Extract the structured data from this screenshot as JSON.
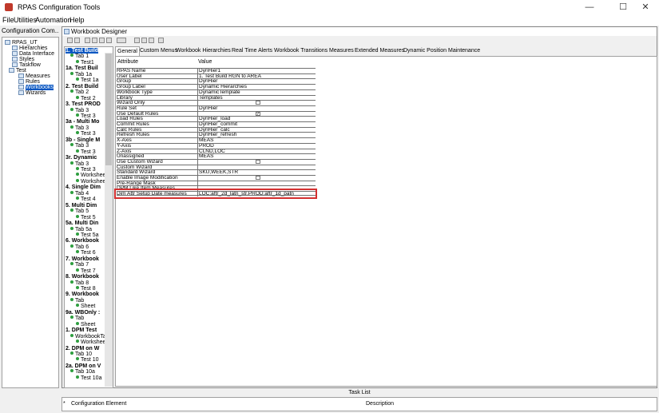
{
  "app": {
    "title": "RPAS Configuration Tools",
    "minimize": "—",
    "maximize": "☐",
    "close": "✕"
  },
  "menu": [
    "File",
    "Utilities",
    "Automation",
    "Help"
  ],
  "left_panel": {
    "title": "Configuration Com...",
    "tree": [
      "RPAS_UT",
      "Hierarchies",
      "Data Interface",
      "Styles",
      "Taskflow",
      "Test",
      "Measures",
      "Rules",
      "Workbooks",
      "Wizards"
    ]
  },
  "designer": {
    "title": "Workbook Designer",
    "workbooks": [
      "1. Test Build",
      "Tab 1",
      "Test1",
      "1a. Test Buil",
      "Tab 1a",
      "Test 1a",
      "2. Test Build",
      "Tab 2",
      "Test 2",
      "3. Test PROD",
      "Tab 3",
      "Test 3",
      "3a - Multi Mo",
      "Tab 3",
      "Test 3",
      "3b - Single M",
      "Tab 3",
      "Test 3",
      "3r. Dynamic",
      "Tab 3",
      "Test 3",
      "Workshee",
      "Workshee",
      "4. Single Dim",
      "Tab 4",
      "Test 4",
      "5. Multi Dim",
      "Tab 5",
      "Test 5",
      "5a. Multi Din",
      "Tab 5a",
      "Test 5a",
      "6. Workbook",
      "Tab 6",
      "Test 6",
      "7. Workbook",
      "Tab 7",
      "Test 7",
      "8. Workbook",
      "Tab 8",
      "Test 8",
      "9. Workbook",
      "Tab",
      "Sheet",
      "9a. WBOnly :",
      "Tab",
      "Sheet",
      "1. DPM Test",
      "WorkbookTa",
      "Workshee",
      "2. DPM on W",
      "Tab 10",
      "Test 10",
      "2a. DPM on V",
      "Tab 10a",
      "Test 10a"
    ],
    "tabs": [
      "General",
      "Custom Menus",
      "Workbook Hierarchies",
      "Real Time Alerts",
      "Workbook Transitions",
      "Measures",
      "Extended Measures",
      "Dynamic Position Maintenance"
    ],
    "columns": {
      "attribute": "Attribute",
      "value": "Value"
    },
    "rows": [
      {
        "a": "RPAS Name",
        "v": "DynHier1"
      },
      {
        "a": "User Label",
        "v": "1. Test Build RGN to AREA"
      },
      {
        "a": "Group",
        "v": "DynHier"
      },
      {
        "a": "Group Label",
        "v": "Dynamic Hierarchies"
      },
      {
        "a": "Workbook Type",
        "v": "DynamicTemplate"
      },
      {
        "a": "Library",
        "v": "Templates"
      },
      {
        "a": "Wizard Only",
        "v": ""
      },
      {
        "a": "Rule Set",
        "v": "DynHier"
      },
      {
        "a": "Use Default Rules",
        "v": ""
      },
      {
        "a": "Load Rules",
        "v": "DynHier_load"
      },
      {
        "a": "Commit Rules",
        "v": "DynHier_commit"
      },
      {
        "a": "Calc Rules",
        "v": "DynHier_calc"
      },
      {
        "a": "Refresh Rules",
        "v": "DynHier_refresh"
      },
      {
        "a": "X-Axis",
        "v": "MEAS"
      },
      {
        "a": "Y-Axis",
        "v": "PROD"
      },
      {
        "a": "Z-Axis",
        "v": "CLND,LOC"
      },
      {
        "a": "Unassigned",
        "v": "MEAS"
      },
      {
        "a": "Use Custom Wizard",
        "v": ""
      },
      {
        "a": "Custom Wizard",
        "v": ""
      },
      {
        "a": "Standard Wizard",
        "v": "SKU,WEEK,STR"
      },
      {
        "a": "Enable Image Modification",
        "v": ""
      },
      {
        "a": "Pre-Range Mask",
        "v": ""
      },
      {
        "a": "DPM Like Item Measures",
        "v": ""
      },
      {
        "a": "Dim Attr Setup Date measures",
        "v": "LOC:aftr_2d_latn_str,PROD:aftr_1d_patn"
      }
    ],
    "use_default_rules_check": "✓"
  },
  "task_list": {
    "title": "Task List",
    "marker": "*",
    "col1": "Configuration Element",
    "col2": "Description"
  }
}
